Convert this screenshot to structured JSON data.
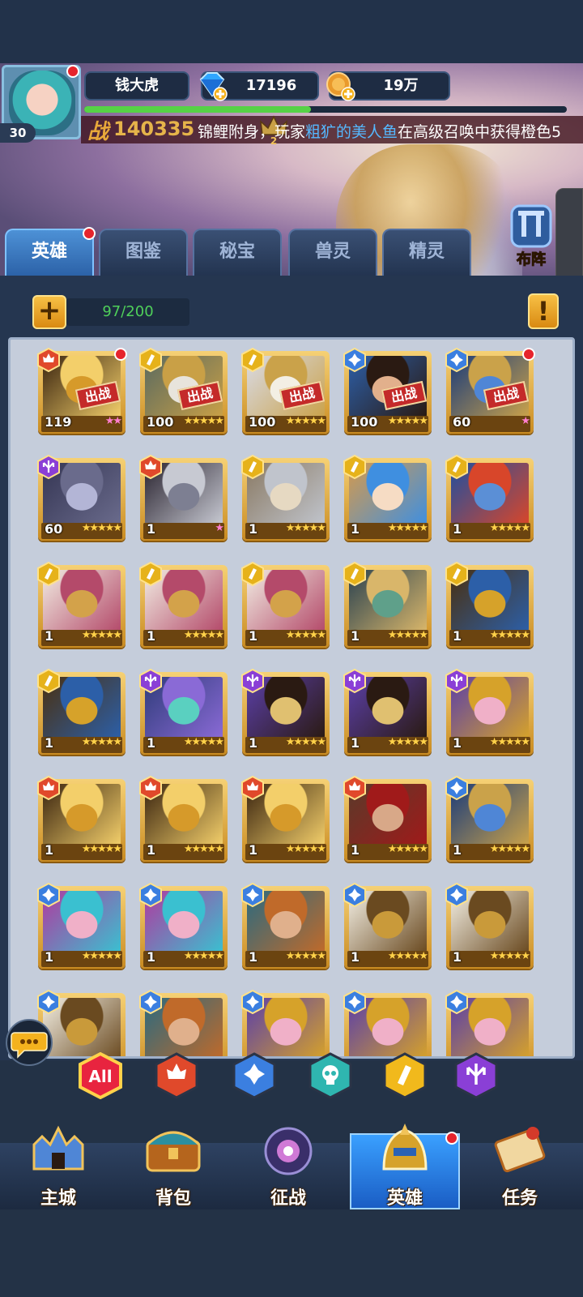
{
  "player": {
    "name": "钱大虎",
    "level": "30",
    "diamonds": "17196",
    "gold": "19万",
    "power_label": "战",
    "power": "140335",
    "exp_fraction": 0.47
  },
  "marquee": {
    "prefix": "锦鲤附身，玩家",
    "player": "粗犷的美人鱼",
    "suffix": "在高级召唤中获得橙色5"
  },
  "vip": {
    "icon": "vip-crown-icon",
    "level": "2"
  },
  "tabs": [
    {
      "label": "英雄",
      "active": true,
      "dot": true
    },
    {
      "label": "图鉴"
    },
    {
      "label": "秘宝"
    },
    {
      "label": "兽灵"
    },
    {
      "label": "精灵"
    }
  ],
  "formation_label": "布阵",
  "hero_count": "97/200",
  "deploy_label": "出战",
  "heroes": [
    {
      "level": "119",
      "faction": "fire",
      "stars": 2,
      "pink": true,
      "deployed": true,
      "dot": true,
      "portrait": "gold-knight"
    },
    {
      "level": "100",
      "faction": "light",
      "stars": 5,
      "deployed": true,
      "portrait": "white-elder"
    },
    {
      "level": "100",
      "faction": "light",
      "stars": 5,
      "deployed": true,
      "portrait": "white-paladin"
    },
    {
      "level": "100",
      "faction": "water",
      "stars": 5,
      "deployed": true,
      "portrait": "dark-hair-hero"
    },
    {
      "level": "60",
      "faction": "water",
      "stars": 1,
      "pink": true,
      "deployed": true,
      "dot": true,
      "portrait": "blue-armor"
    },
    {
      "level": "60",
      "faction": "dark",
      "stars": 5,
      "portrait": "dark-elf"
    },
    {
      "level": "1",
      "faction": "fire",
      "stars": 1,
      "pink": true,
      "portrait": "grey-elf"
    },
    {
      "level": "1",
      "faction": "light",
      "stars": 5,
      "portrait": "silver-valkyrie"
    },
    {
      "level": "1",
      "faction": "light",
      "stars": 5,
      "portrait": "blonde-girl"
    },
    {
      "level": "1",
      "faction": "light",
      "stars": 5,
      "portrait": "red-troll"
    },
    {
      "level": "1",
      "faction": "light",
      "stars": 5,
      "portrait": "hooded-gold"
    },
    {
      "level": "1",
      "faction": "light",
      "stars": 5,
      "portrait": "hooded-gold"
    },
    {
      "level": "1",
      "faction": "light",
      "stars": 5,
      "portrait": "hooded-gold"
    },
    {
      "level": "1",
      "faction": "light",
      "stars": 5,
      "portrait": "green-orc"
    },
    {
      "level": "1",
      "faction": "light",
      "stars": 5,
      "portrait": "gold-golem"
    },
    {
      "level": "1",
      "faction": "light",
      "stars": 5,
      "portrait": "gold-golem"
    },
    {
      "level": "1",
      "faction": "dark",
      "stars": 5,
      "portrait": "blue-sprite"
    },
    {
      "level": "1",
      "faction": "dark",
      "stars": 5,
      "portrait": "masked-mage"
    },
    {
      "level": "1",
      "faction": "dark",
      "stars": 5,
      "portrait": "masked-mage"
    },
    {
      "level": "1",
      "faction": "dark",
      "stars": 5,
      "portrait": "purple-witch"
    },
    {
      "level": "1",
      "faction": "fire",
      "stars": 5,
      "portrait": "gold-knight"
    },
    {
      "level": "1",
      "faction": "fire",
      "stars": 5,
      "portrait": "gold-knight"
    },
    {
      "level": "1",
      "faction": "fire",
      "stars": 5,
      "portrait": "gold-knight"
    },
    {
      "level": "1",
      "faction": "fire",
      "stars": 5,
      "portrait": "scarred-warrior"
    },
    {
      "level": "1",
      "faction": "water",
      "stars": 5,
      "portrait": "blue-armor"
    },
    {
      "level": "1",
      "faction": "water",
      "stars": 5,
      "portrait": "pink-sorceress"
    },
    {
      "level": "1",
      "faction": "water",
      "stars": 5,
      "portrait": "pink-sorceress"
    },
    {
      "level": "1",
      "faction": "water",
      "stars": 5,
      "portrait": "goggles-dwarf"
    },
    {
      "level": "1",
      "faction": "water",
      "stars": 5,
      "portrait": "gold-helm"
    },
    {
      "level": "1",
      "faction": "water",
      "stars": 5,
      "portrait": "gold-helm"
    },
    {
      "level": "",
      "faction": "water",
      "stars": 0,
      "portrait": "gold-helm",
      "partial": true
    },
    {
      "level": "",
      "faction": "water",
      "stars": 0,
      "portrait": "goggles-dwarf",
      "partial": true
    },
    {
      "level": "",
      "faction": "water",
      "stars": 0,
      "portrait": "purple-witch",
      "partial": true
    },
    {
      "level": "",
      "faction": "water",
      "stars": 0,
      "portrait": "purple-witch",
      "partial": true
    },
    {
      "level": "",
      "faction": "water",
      "stars": 0,
      "portrait": "purple-witch",
      "partial": true
    }
  ],
  "filters": [
    {
      "label": "All",
      "icon": "all-filter-icon",
      "color": "#e8243f"
    },
    {
      "icon": "fire-faction-icon",
      "color": "#e0492b"
    },
    {
      "icon": "water-faction-icon",
      "color": "#3b7fe0"
    },
    {
      "icon": "skull-faction-icon",
      "color": "#2fb6b0"
    },
    {
      "icon": "light-faction-icon",
      "color": "#f1b91c"
    },
    {
      "icon": "dark-faction-icon",
      "color": "#8a3fd6"
    }
  ],
  "nav": [
    {
      "label": "主城",
      "icon": "castle-icon"
    },
    {
      "label": "背包",
      "icon": "chest-icon"
    },
    {
      "label": "征战",
      "icon": "dragon-portal-icon"
    },
    {
      "label": "英雄",
      "icon": "hero-helmet-icon",
      "active": true,
      "dot": true
    },
    {
      "label": "任务",
      "icon": "scroll-icon"
    }
  ],
  "colors": {
    "fire": "#e0492b",
    "water": "#3b7fe0",
    "light": "#e6b21a",
    "dark": "#8a3fd6",
    "accent": "#3aa0ff",
    "exp": "#56d246"
  }
}
